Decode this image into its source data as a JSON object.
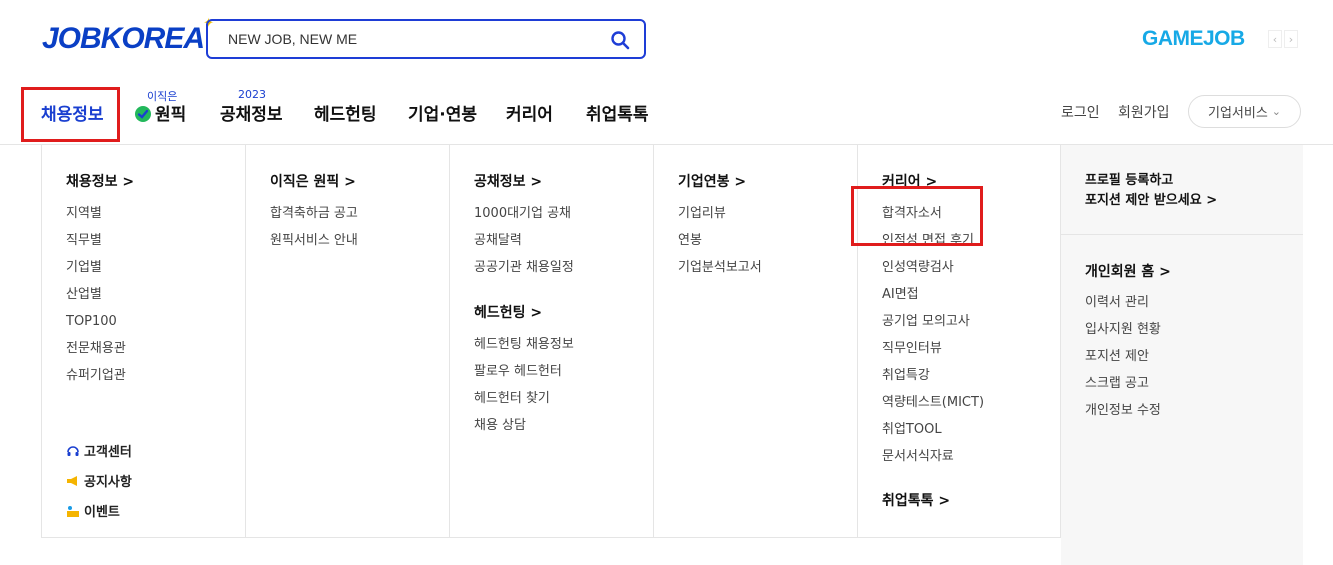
{
  "header": {
    "logo": "JOBKOREA",
    "search": {
      "placeholder": "NEW JOB, NEW ME"
    },
    "gamejob": "GAMEJOB",
    "arrow_prev": "‹",
    "arrow_next": "›"
  },
  "gnb": {
    "items": [
      {
        "label": "채용정보",
        "sup": ""
      },
      {
        "label": "원픽",
        "sup": "이직은"
      },
      {
        "label": "공채정보",
        "sup": "2023"
      },
      {
        "label": "헤드헌팅",
        "sup": ""
      },
      {
        "label": "기업·연봉",
        "sup": ""
      },
      {
        "label": "커리어",
        "sup": ""
      },
      {
        "label": "취업톡톡",
        "sup": ""
      }
    ],
    "login": "로그인",
    "signup": "회원가입",
    "biz": "기업서비스",
    "biz_caret": "⌄"
  },
  "menu": {
    "col1": {
      "head": "채용정보 >",
      "items": [
        "지역별",
        "직무별",
        "기업별",
        "산업별",
        "TOP100",
        "전문채용관",
        "슈퍼기업관"
      ]
    },
    "col1_links": [
      "고객센터",
      "공지사항",
      "이벤트"
    ],
    "col2": {
      "head": "이직은 원픽 >",
      "items": [
        "합격축하금 공고",
        "원픽서비스 안내"
      ]
    },
    "col3": {
      "head": "공채정보 >",
      "items": [
        "1000대기업 공채",
        "공채달력",
        "공공기관 채용일정"
      ],
      "head2": "헤드헌팅 >",
      "items2": [
        "헤드헌팅 채용정보",
        "팔로우 헤드헌터",
        "헤드헌터 찾기",
        "채용 상담"
      ]
    },
    "col4": {
      "head": "기업연봉 >",
      "items": [
        "기업리뷰",
        "연봉",
        "기업분석보고서"
      ]
    },
    "col5": {
      "head": "커리어 >",
      "items": [
        "합격자소서",
        "인적성 면접 후기",
        "인성역량검사",
        "AI면접",
        "공기업 모의고사",
        "직무인터뷰",
        "취업특강",
        "역량테스트(MICT)",
        "취업TOOL",
        "문서서식자료"
      ],
      "head2": "취업톡톡 >"
    },
    "side": {
      "promo_line1": "프로필 등록하고",
      "promo_line2": "포지션 제안 받으세요 >",
      "head": "개인회원 홈 >",
      "items": [
        "이력서 관리",
        "입사지원 현황",
        "포지션 제안",
        "스크랩 공고",
        "개인정보 수정"
      ]
    }
  },
  "colors": {
    "brand_blue": "#1a3fd0",
    "highlight_red": "#e01c1c",
    "gamejob_blue": "#17a9e6"
  }
}
